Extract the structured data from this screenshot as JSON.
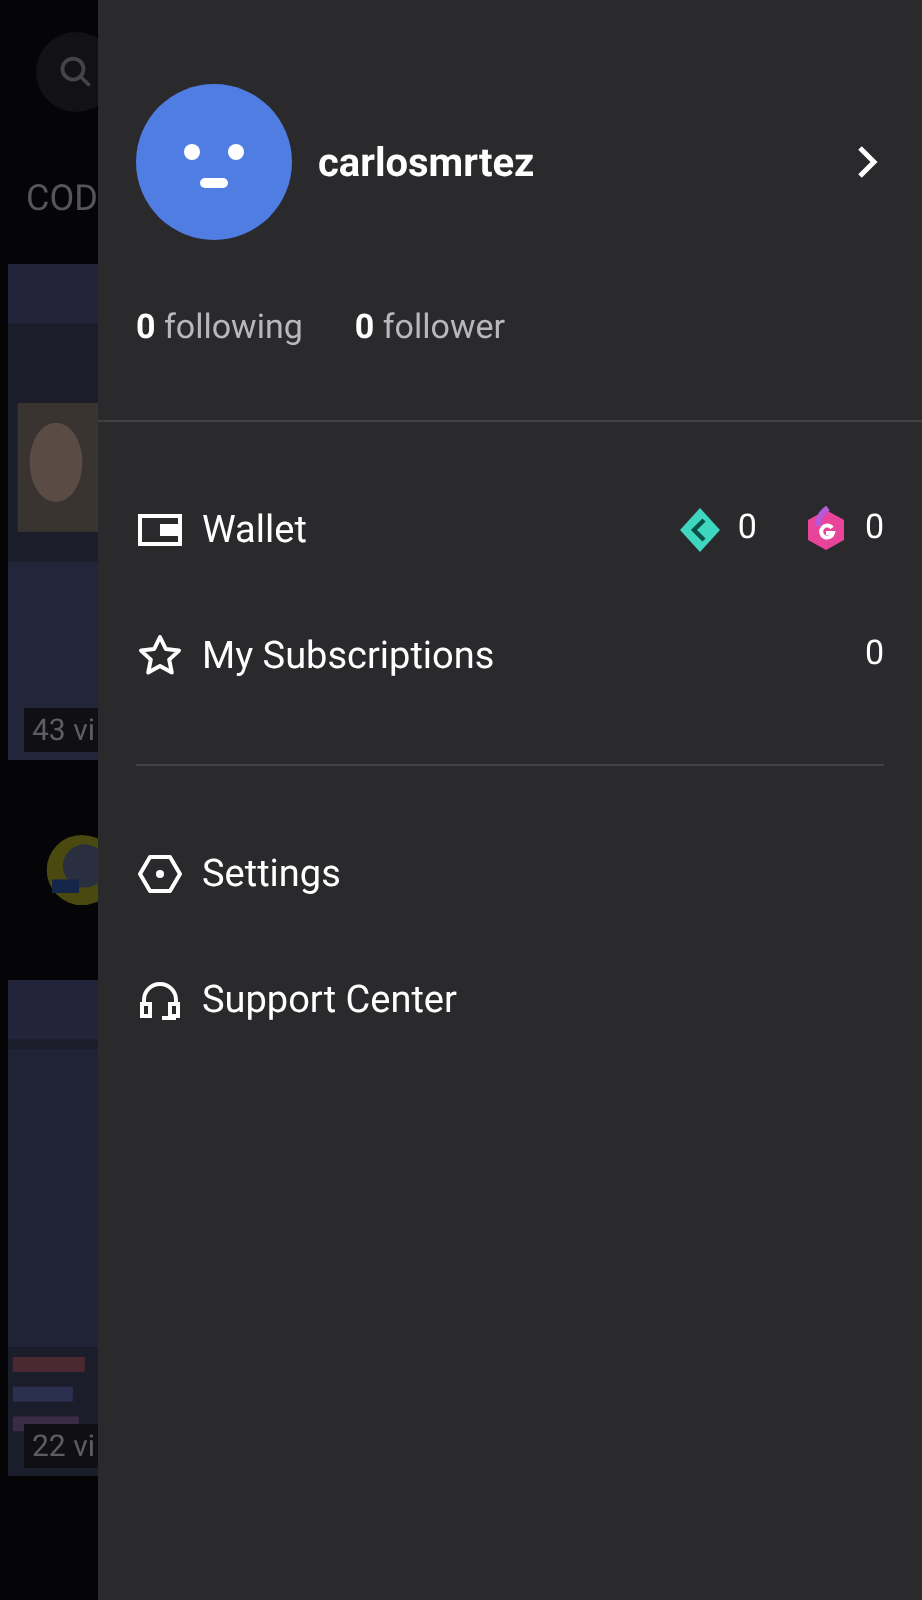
{
  "background": {
    "tab_label": "COD",
    "videos": [
      {
        "views": "43 vi"
      },
      {
        "views": "22 vi"
      }
    ]
  },
  "profile": {
    "username": "carlosmrtez",
    "stats": [
      {
        "count": "0",
        "label": "following"
      },
      {
        "count": "0",
        "label": "follower"
      }
    ]
  },
  "menu_groups": [
    {
      "items": [
        {
          "kind": "wallet",
          "label": "Wallet",
          "balances": [
            {
              "kind": "diamond",
              "amount": "0"
            },
            {
              "kind": "coin",
              "amount": "0"
            }
          ]
        },
        {
          "kind": "subscriptions",
          "label": "My Subscriptions",
          "count": "0"
        }
      ]
    },
    {
      "items": [
        {
          "kind": "settings",
          "label": "Settings"
        },
        {
          "kind": "support",
          "label": "Support Center"
        }
      ]
    }
  ]
}
